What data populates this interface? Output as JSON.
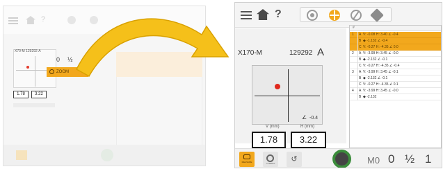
{
  "left_preview": {
    "card_code": "X70-M",
    "card_serial": "129292",
    "card_orientation": "A",
    "zero": "0",
    "half": "½",
    "zoom_label": "ZOOM",
    "values": [
      "1.78",
      "3.22"
    ]
  },
  "topbar": {
    "help": "?",
    "tabs": [
      "crosshair-target-tab",
      "crosshair-active-tab",
      "edit-tab",
      "diamond-tab"
    ]
  },
  "main": {
    "code": "X170-M",
    "serial": "129292",
    "orientation": "A",
    "angle_symbol": "∠",
    "angle_value": "-0.4",
    "v_label": "V (mm)",
    "h_label": "H (mm)",
    "v_value": "1.78",
    "h_value": "3.22"
  },
  "table": {
    "header": "#",
    "rows": [
      {
        "n": "1",
        "s": "A",
        "d": "V: -0.08 H: 3.40 ∠ -0.4",
        "sel": true
      },
      {
        "n": "",
        "s": "B",
        "d": "◆ -1.132 ∠ -0.4",
        "sel": true
      },
      {
        "n": "",
        "s": "C",
        "d": "V: -0.27 H: -4.35 ∠ 0.0",
        "sel": true
      },
      {
        "n": "2",
        "s": "A",
        "d": "V: -3.99 H: 3.45 ∠ -0.0",
        "sel": false
      },
      {
        "n": "",
        "s": "B",
        "d": "◆ -2.132 ∠ -0.1",
        "sel": false
      },
      {
        "n": "",
        "s": "C",
        "d": "V: -0.27 H: -4.35 ∠ -0.4",
        "sel": false
      },
      {
        "n": "3",
        "s": "A",
        "d": "V: -3.99 H: 3.45 ∠ -0.1",
        "sel": false
      },
      {
        "n": "",
        "s": "B",
        "d": "◆ -2.132 ∠ -0.1",
        "sel": false
      },
      {
        "n": "",
        "s": "C",
        "d": "V: -0.27 H: -4.35 ∠ 0.1",
        "sel": false
      },
      {
        "n": "4",
        "s": "A",
        "d": "V: -3.99 H: 3.45 ∠ -0.0",
        "sel": false
      },
      {
        "n": "",
        "s": "B",
        "d": "◆ -2.132",
        "sel": false
      }
    ]
  },
  "bottombar": {
    "active_label": "MEASURE",
    "camera_label": "CAMERA",
    "undo": "↺",
    "m0": "M0",
    "zero": "0",
    "half": "½",
    "one": "1"
  },
  "colors": {
    "accent": "#f2a81d",
    "target_dot": "#e0291d",
    "go_button": "#3b8c3b"
  }
}
